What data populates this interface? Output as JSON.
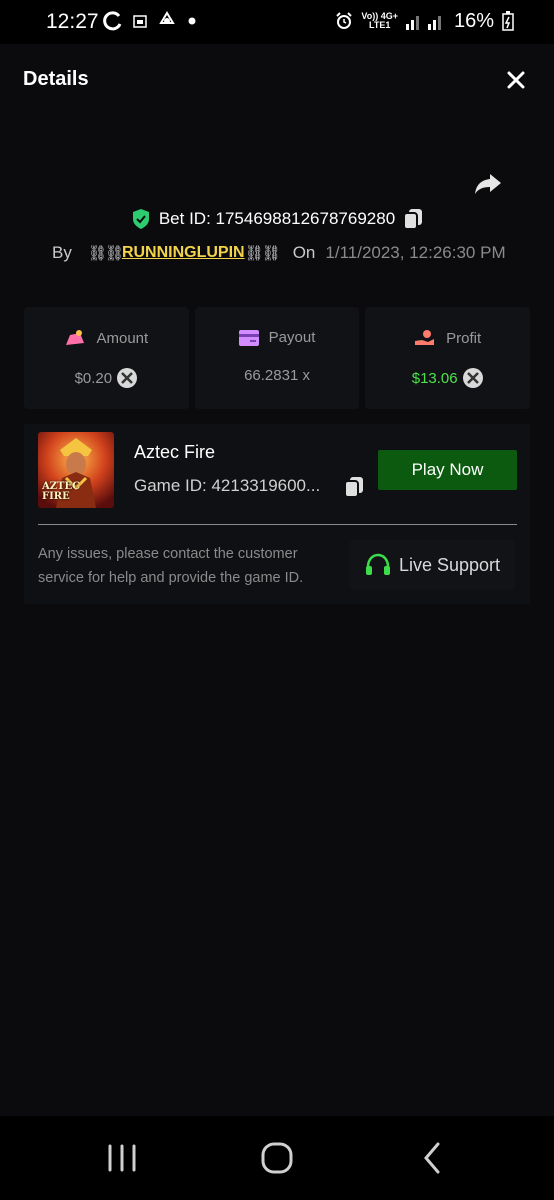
{
  "status_bar": {
    "time": "12:27",
    "network_top": "Vo)) 4G+",
    "network_bottom": "LTE1",
    "battery_percent": "16%",
    "icons": [
      "sync-icon",
      "calendar-icon",
      "recycle-icon",
      "notification-dot",
      "alarm-icon",
      "signal-icon",
      "battery-icon"
    ]
  },
  "header": {
    "title": "Details",
    "close_icon": "close-icon"
  },
  "bet": {
    "bet_id_text": "Bet ID: 1754698812678769280",
    "by_label": "By",
    "chain_left": "⛓⛓",
    "username": "RUNNINGLUPIN",
    "chain_right": "⛓⛓",
    "on_label": "On",
    "date": "1/11/2023, 12:26:30 PM"
  },
  "stats": {
    "amount": {
      "label": "Amount",
      "value": "$0.20"
    },
    "payout": {
      "label": "Payout",
      "value": "66.2831 x"
    },
    "profit": {
      "label": "Profit",
      "value": "$13.06"
    }
  },
  "game": {
    "name": "Aztec Fire",
    "game_id_text": "Game ID: 4213319600...",
    "thumb_line1": "AZTEC",
    "thumb_line2": "FIRE",
    "play_label": "Play Now",
    "help_text": "Any issues, please contact the customer service for help and provide the game ID.",
    "support_label": "Live Support"
  },
  "colors": {
    "accent_green": "#0c5a10",
    "profit_green": "#4ee24e",
    "username_yellow": "#f3d34a",
    "shield_green": "#2ecc71",
    "support_green": "#3ddc4a"
  }
}
